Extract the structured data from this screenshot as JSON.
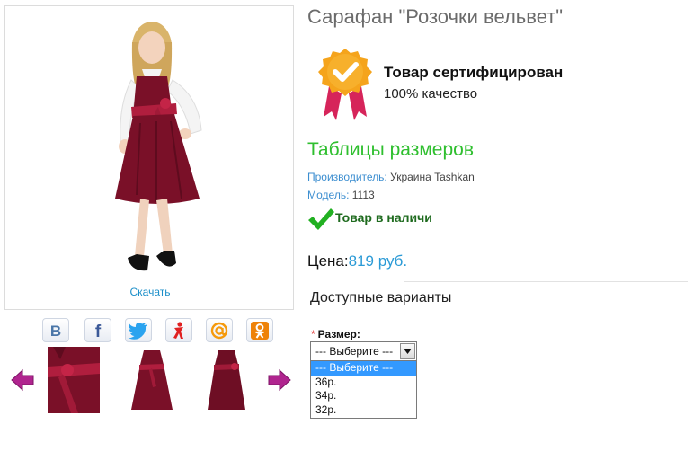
{
  "product": {
    "title": "Сарафан \"Розочки вельвет\"",
    "download_label": "Скачать",
    "certificate": {
      "title": "Товар сертифицирован",
      "subtitle": "100% качество"
    },
    "size_table_label": "Таблицы размеров",
    "manufacturer": {
      "label": "Производитель:",
      "value": "Украина Tashkan"
    },
    "model": {
      "label": "Модель:",
      "value": "1113"
    },
    "stock_label": "Товар в наличи",
    "price": {
      "label": "Цена:",
      "value": "819 руб."
    }
  },
  "share": [
    {
      "icon": "vkontakte-icon",
      "color": "#4a76a8"
    },
    {
      "icon": "facebook-icon",
      "color": "#3b5998"
    },
    {
      "icon": "twitter-icon",
      "color": "#1da1f2"
    },
    {
      "icon": "yaru-icon",
      "color": "#e02020"
    },
    {
      "icon": "mailru-icon",
      "color": "#f59a0c"
    },
    {
      "icon": "odnoklassniki-icon",
      "color": "#ee8208"
    }
  ],
  "colors": {
    "dress": "#7a1028",
    "accent_green": "#2fbf2f",
    "link_blue": "#2a9ad6",
    "arrow_purple": "#b0258f"
  },
  "variants": {
    "title": "Доступные варианты",
    "size_label": "Размер:",
    "required_mark": "*",
    "select_value": "--- Выберите ---",
    "options": [
      "--- Выберите ---",
      "36р.",
      "34р.",
      "32р."
    ]
  }
}
